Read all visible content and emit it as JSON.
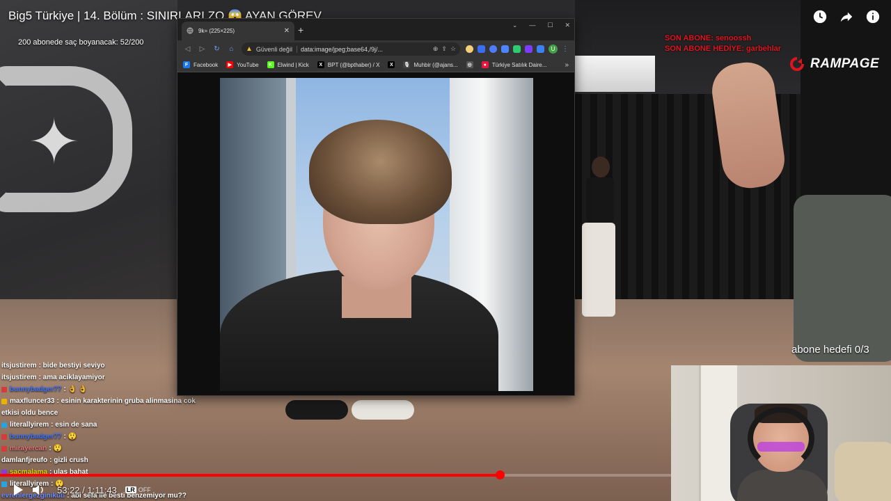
{
  "video": {
    "title": "Big5 Türkiye | 14. Bölüm : SINIRLARI ZO",
    "title_tail": "AYAN GÖREV",
    "goal_text": "200 abonede saç boyanacak: 52/200",
    "sub_alert_line1": "SON ABONE: senoossh",
    "sub_alert_line2": "SON ABONE HEDİYE: garbehlar",
    "brand": "RAMPAGE",
    "abone_hedefi": "abone hedefi 0/3"
  },
  "yt_icons": [
    "clock-icon",
    "share-icon",
    "info-icon"
  ],
  "browser": {
    "tab_title": "9k= (225×225)",
    "security_label": "Güvenli değil",
    "url": "data:image/jpeg;base64,/9j/...",
    "profile_initial": "U",
    "bookmarks": [
      {
        "label": "Facebook",
        "icon": "F",
        "color": "#1877f2"
      },
      {
        "label": "YouTube",
        "icon": "▶",
        "color": "#ff0000"
      },
      {
        "label": "Elwind | Kick",
        "icon": "K",
        "color": "#53fc18"
      },
      {
        "label": "BPT (@bpthaber) / X",
        "icon": "X",
        "color": "#000000"
      },
      {
        "label": "",
        "icon": "X",
        "color": "#000000"
      },
      {
        "label": "Muhbir (@ajans...",
        "icon": "🎙",
        "color": "#444444"
      },
      {
        "label": "",
        "icon": "◎",
        "color": "#555555"
      },
      {
        "label": "Türkiye Satılık Daire...",
        "icon": "●",
        "color": "#e5173f"
      }
    ]
  },
  "chat": [
    {
      "user": "itsjustirem",
      "msg": ": bide bestiyi seviyo",
      "color": "#ffffff",
      "badge": ""
    },
    {
      "user": "itsjustirem",
      "msg": ": ama aciklayamiyor",
      "color": "#ffffff",
      "badge": ""
    },
    {
      "user": "bunnybadger77",
      "msg": ": 👌 👌",
      "color": "#3b73ff",
      "badge": "#d43c3c"
    },
    {
      "user": "maxfluncer33",
      "msg": ": esinin karakterinin gruba alinmasina cok",
      "color": "#ffffff",
      "badge": "#e8b400"
    },
    {
      "user": "",
      "msg": "etkisi oldu bence",
      "color": "#ffffff",
      "badge": ""
    },
    {
      "user": "literallyirem",
      "msg": ": esin de sana",
      "color": "#ffffff",
      "badge": "#29a3e0"
    },
    {
      "user": "bunnybadger77",
      "msg": ": 😲",
      "color": "#3b73ff",
      "badge": "#d43c3c"
    },
    {
      "user": "mirayercan",
      "msg": ": 😲",
      "color": "#e07474",
      "badge": "#d43c3c"
    },
    {
      "user": "damlanfjreufo",
      "msg": ": gizli crush",
      "color": "#ffffff",
      "badge": ""
    },
    {
      "user": "sacmalama",
      "msg": ": ulaş bahat",
      "color": "#e8d000",
      "badge": "#8a3cd4"
    },
    {
      "user": "literallyirem",
      "msg": ": 😲",
      "color": "#ffffff",
      "badge": "#29a3e0"
    },
    {
      "user": "evrenlergezginikuti",
      "msg": ": abi sefa ile besti benzemiyor mu??",
      "color": "#6a8cff",
      "badge": ""
    }
  ],
  "player": {
    "time": "53:22 / 1:11:43",
    "progress": 0.7445,
    "autoplay_label": "OFF"
  }
}
